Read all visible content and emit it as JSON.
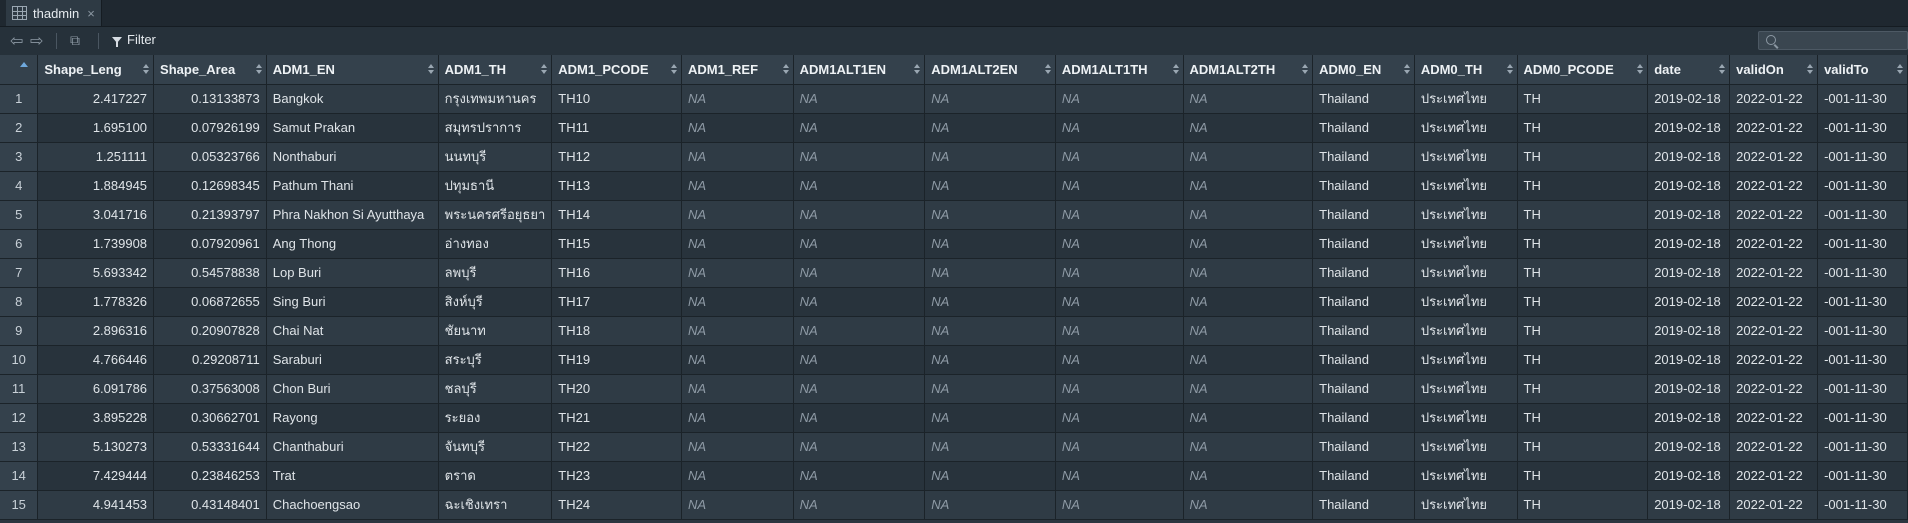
{
  "tab": {
    "title": "thadmin",
    "close": "×"
  },
  "toolbar": {
    "filter_label": "Filter",
    "search_placeholder": ""
  },
  "columns": [
    "Shape_Leng",
    "Shape_Area",
    "ADM1_EN",
    "ADM1_TH",
    "ADM1_PCODE",
    "ADM1_REF",
    "ADM1ALT1EN",
    "ADM1ALT2EN",
    "ADM1ALT1TH",
    "ADM1ALT2TH",
    "ADM0_EN",
    "ADM0_TH",
    "ADM0_PCODE",
    "date",
    "validOn",
    "validTo"
  ],
  "rows": [
    [
      "1",
      "2.417227",
      "0.13133873",
      "Bangkok",
      "กรุงเทพมหานคร",
      "TH10",
      "NA",
      "NA",
      "NA",
      "NA",
      "NA",
      "Thailand",
      "ประเทศไทย",
      "TH",
      "2019-02-18",
      "2022-01-22",
      "-001-11-30"
    ],
    [
      "2",
      "1.695100",
      "0.07926199",
      "Samut Prakan",
      "สมุทรปราการ",
      "TH11",
      "NA",
      "NA",
      "NA",
      "NA",
      "NA",
      "Thailand",
      "ประเทศไทย",
      "TH",
      "2019-02-18",
      "2022-01-22",
      "-001-11-30"
    ],
    [
      "3",
      "1.251111",
      "0.05323766",
      "Nonthaburi",
      "นนทบุรี",
      "TH12",
      "NA",
      "NA",
      "NA",
      "NA",
      "NA",
      "Thailand",
      "ประเทศไทย",
      "TH",
      "2019-02-18",
      "2022-01-22",
      "-001-11-30"
    ],
    [
      "4",
      "1.884945",
      "0.12698345",
      "Pathum Thani",
      "ปทุมธานี",
      "TH13",
      "NA",
      "NA",
      "NA",
      "NA",
      "NA",
      "Thailand",
      "ประเทศไทย",
      "TH",
      "2019-02-18",
      "2022-01-22",
      "-001-11-30"
    ],
    [
      "5",
      "3.041716",
      "0.21393797",
      "Phra Nakhon Si Ayutthaya",
      "พระนครศรีอยุธยา",
      "TH14",
      "NA",
      "NA",
      "NA",
      "NA",
      "NA",
      "Thailand",
      "ประเทศไทย",
      "TH",
      "2019-02-18",
      "2022-01-22",
      "-001-11-30"
    ],
    [
      "6",
      "1.739908",
      "0.07920961",
      "Ang Thong",
      "อ่างทอง",
      "TH15",
      "NA",
      "NA",
      "NA",
      "NA",
      "NA",
      "Thailand",
      "ประเทศไทย",
      "TH",
      "2019-02-18",
      "2022-01-22",
      "-001-11-30"
    ],
    [
      "7",
      "5.693342",
      "0.54578838",
      "Lop Buri",
      "ลพบุรี",
      "TH16",
      "NA",
      "NA",
      "NA",
      "NA",
      "NA",
      "Thailand",
      "ประเทศไทย",
      "TH",
      "2019-02-18",
      "2022-01-22",
      "-001-11-30"
    ],
    [
      "8",
      "1.778326",
      "0.06872655",
      "Sing Buri",
      "สิงห์บุรี",
      "TH17",
      "NA",
      "NA",
      "NA",
      "NA",
      "NA",
      "Thailand",
      "ประเทศไทย",
      "TH",
      "2019-02-18",
      "2022-01-22",
      "-001-11-30"
    ],
    [
      "9",
      "2.896316",
      "0.20907828",
      "Chai Nat",
      "ชัยนาท",
      "TH18",
      "NA",
      "NA",
      "NA",
      "NA",
      "NA",
      "Thailand",
      "ประเทศไทย",
      "TH",
      "2019-02-18",
      "2022-01-22",
      "-001-11-30"
    ],
    [
      "10",
      "4.766446",
      "0.29208711",
      "Saraburi",
      "สระบุรี",
      "TH19",
      "NA",
      "NA",
      "NA",
      "NA",
      "NA",
      "Thailand",
      "ประเทศไทย",
      "TH",
      "2019-02-18",
      "2022-01-22",
      "-001-11-30"
    ],
    [
      "11",
      "6.091786",
      "0.37563008",
      "Chon Buri",
      "ชลบุรี",
      "TH20",
      "NA",
      "NA",
      "NA",
      "NA",
      "NA",
      "Thailand",
      "ประเทศไทย",
      "TH",
      "2019-02-18",
      "2022-01-22",
      "-001-11-30"
    ],
    [
      "12",
      "3.895228",
      "0.30662701",
      "Rayong",
      "ระยอง",
      "TH21",
      "NA",
      "NA",
      "NA",
      "NA",
      "NA",
      "Thailand",
      "ประเทศไทย",
      "TH",
      "2019-02-18",
      "2022-01-22",
      "-001-11-30"
    ],
    [
      "13",
      "5.130273",
      "0.53331644",
      "Chanthaburi",
      "จันทบุรี",
      "TH22",
      "NA",
      "NA",
      "NA",
      "NA",
      "NA",
      "Thailand",
      "ประเทศไทย",
      "TH",
      "2019-02-18",
      "2022-01-22",
      "-001-11-30"
    ],
    [
      "14",
      "7.429444",
      "0.23846253",
      "Trat",
      "ตราด",
      "TH23",
      "NA",
      "NA",
      "NA",
      "NA",
      "NA",
      "Thailand",
      "ประเทศไทย",
      "TH",
      "2019-02-18",
      "2022-01-22",
      "-001-11-30"
    ],
    [
      "15",
      "4.941453",
      "0.43148401",
      "Chachoengsao",
      "ฉะเชิงเทรา",
      "TH24",
      "NA",
      "NA",
      "NA",
      "NA",
      "NA",
      "Thailand",
      "ประเทศไทย",
      "TH",
      "2019-02-18",
      "2022-01-22",
      "-001-11-30"
    ]
  ]
}
